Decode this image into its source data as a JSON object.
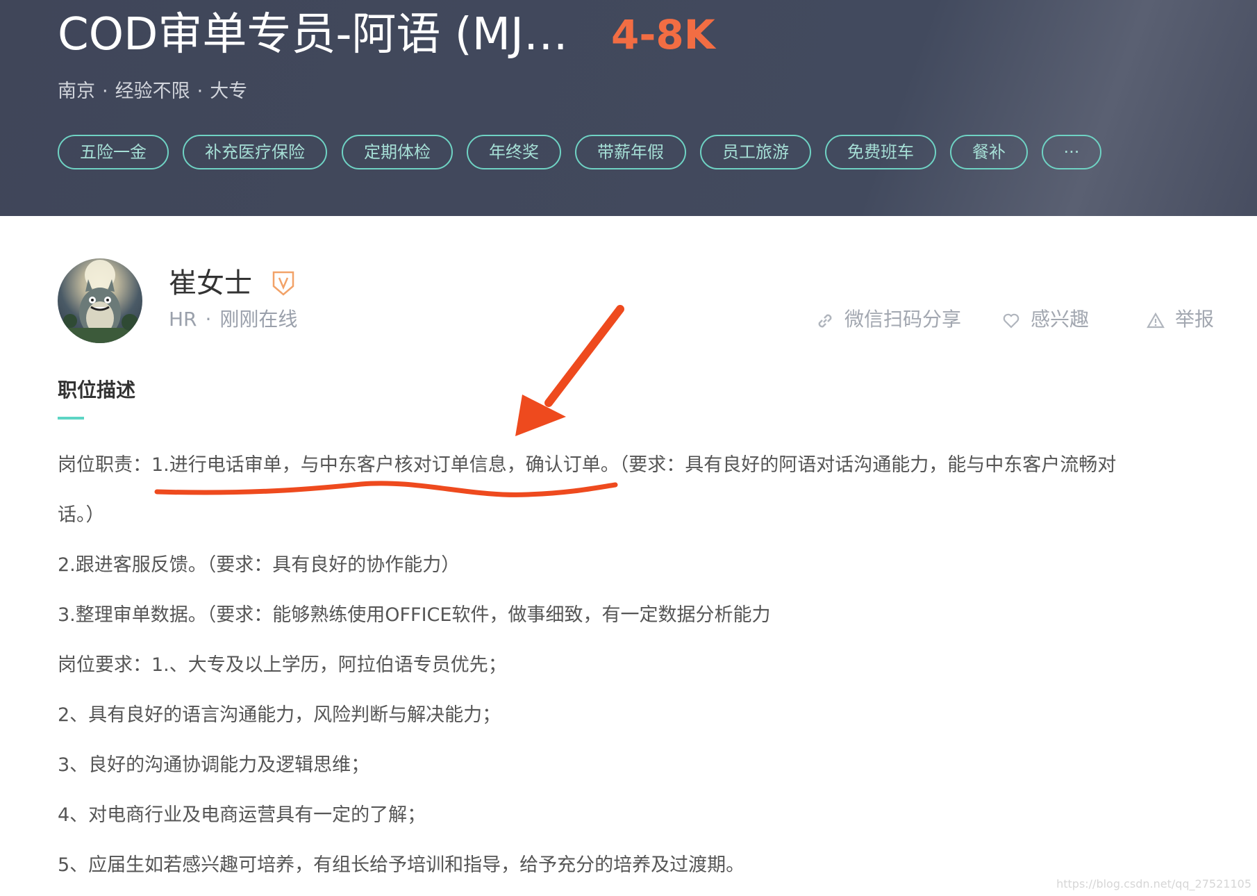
{
  "job": {
    "title": "COD审单专员-阿语 (MJ…",
    "salary": "4-8K",
    "meta": {
      "city": "南京",
      "experience": "经验不限",
      "education": "大专"
    },
    "tags": [
      "五险一金",
      "补充医疗保险",
      "定期体检",
      "年终奖",
      "带薪年假",
      "员工旅游",
      "免费班车",
      "餐补",
      "···"
    ]
  },
  "hr": {
    "name": "崔女士",
    "role": "HR",
    "status": "刚刚在线"
  },
  "actions": {
    "share": "微信扫码分享",
    "interest": "感兴趣",
    "report": "举报"
  },
  "description": {
    "title": "职位描述",
    "lines": [
      "岗位职责：1.进行电话审单，与中东客户核对订单信息，确认订单。（要求：具有良好的阿语对话沟通能力，能与中东客户流畅对",
      "话。）",
      "2.跟进客服反馈。（要求：具有良好的协作能力）",
      "3.整理审单数据。（要求：能够熟练使用OFFICE软件，做事细致，有一定数据分析能力",
      "岗位要求：1.、大专及以上学历，阿拉伯语专员优先；",
      "2、具有良好的语言沟通能力，风险判断与解决能力；",
      "3、良好的沟通协调能力及逻辑思维；",
      "4、对电商行业及电商运营具有一定的了解；",
      "5、应届生如若感兴趣可培养，有组长给予培训和指导，给予充分的培养及过渡期。"
    ]
  },
  "watermark": "https://blog.csdn.net/qq_27521105",
  "colors": {
    "header_bg": "#424a5e",
    "salary": "#f26d43",
    "tag_border": "#6fd3c4",
    "annotation": "#ee4a1e"
  }
}
